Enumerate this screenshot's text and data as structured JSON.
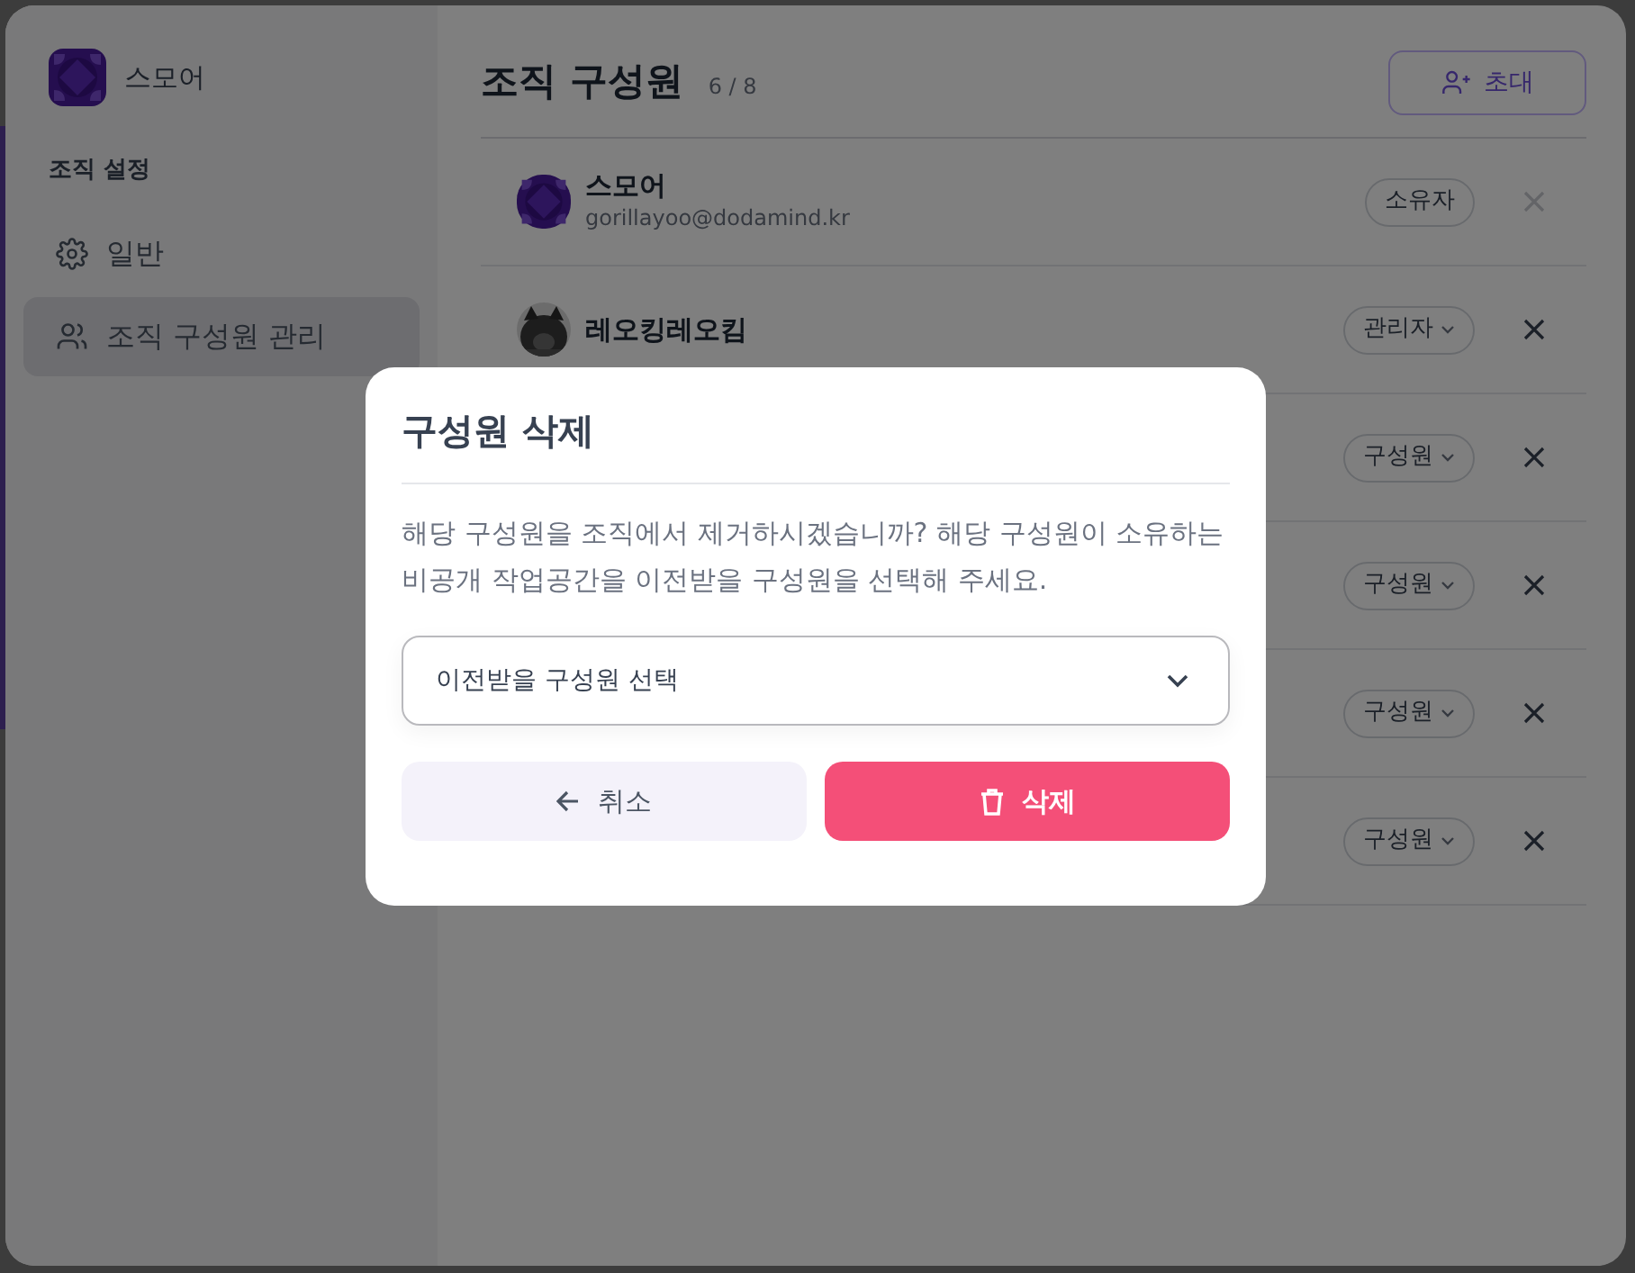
{
  "sidebar": {
    "org_name": "스모어",
    "section": "조직 설정",
    "items": [
      {
        "label": "일반",
        "kind": "general",
        "selected": false
      },
      {
        "label": "조직 구성원 관리",
        "kind": "members",
        "selected": true
      }
    ]
  },
  "header": {
    "title": "조직 구성원",
    "count": "6 / 8",
    "invite_button": "초대"
  },
  "members": [
    {
      "name": "스모어",
      "email": "gorillayoo@dodamind.kr",
      "avatar": {
        "kind": "logo"
      },
      "role": "소유자",
      "role_editable": false,
      "removable": false
    },
    {
      "name": "레오킹레오킴",
      "role": "관리자",
      "role_editable": true,
      "removable": true
    },
    {
      "role": "구성원",
      "role_editable": true,
      "removable": true
    },
    {
      "role": "구성원",
      "role_editable": true,
      "removable": true
    },
    {
      "role": "구성원",
      "role_editable": true,
      "removable": true
    },
    {
      "role": "구성원",
      "role_editable": true,
      "removable": true
    }
  ],
  "dialog": {
    "title": "구성원 삭제",
    "message": "해당 구성원을 조직에서 제거하시겠습니까? 해당 구성원이 소유하는 비공개 작업공간을 이전받을 구성원을 선택해 주세요.",
    "select_placeholder": "이전받을 구성원 선택",
    "cancel_button": "취소",
    "delete_button": "삭제"
  }
}
